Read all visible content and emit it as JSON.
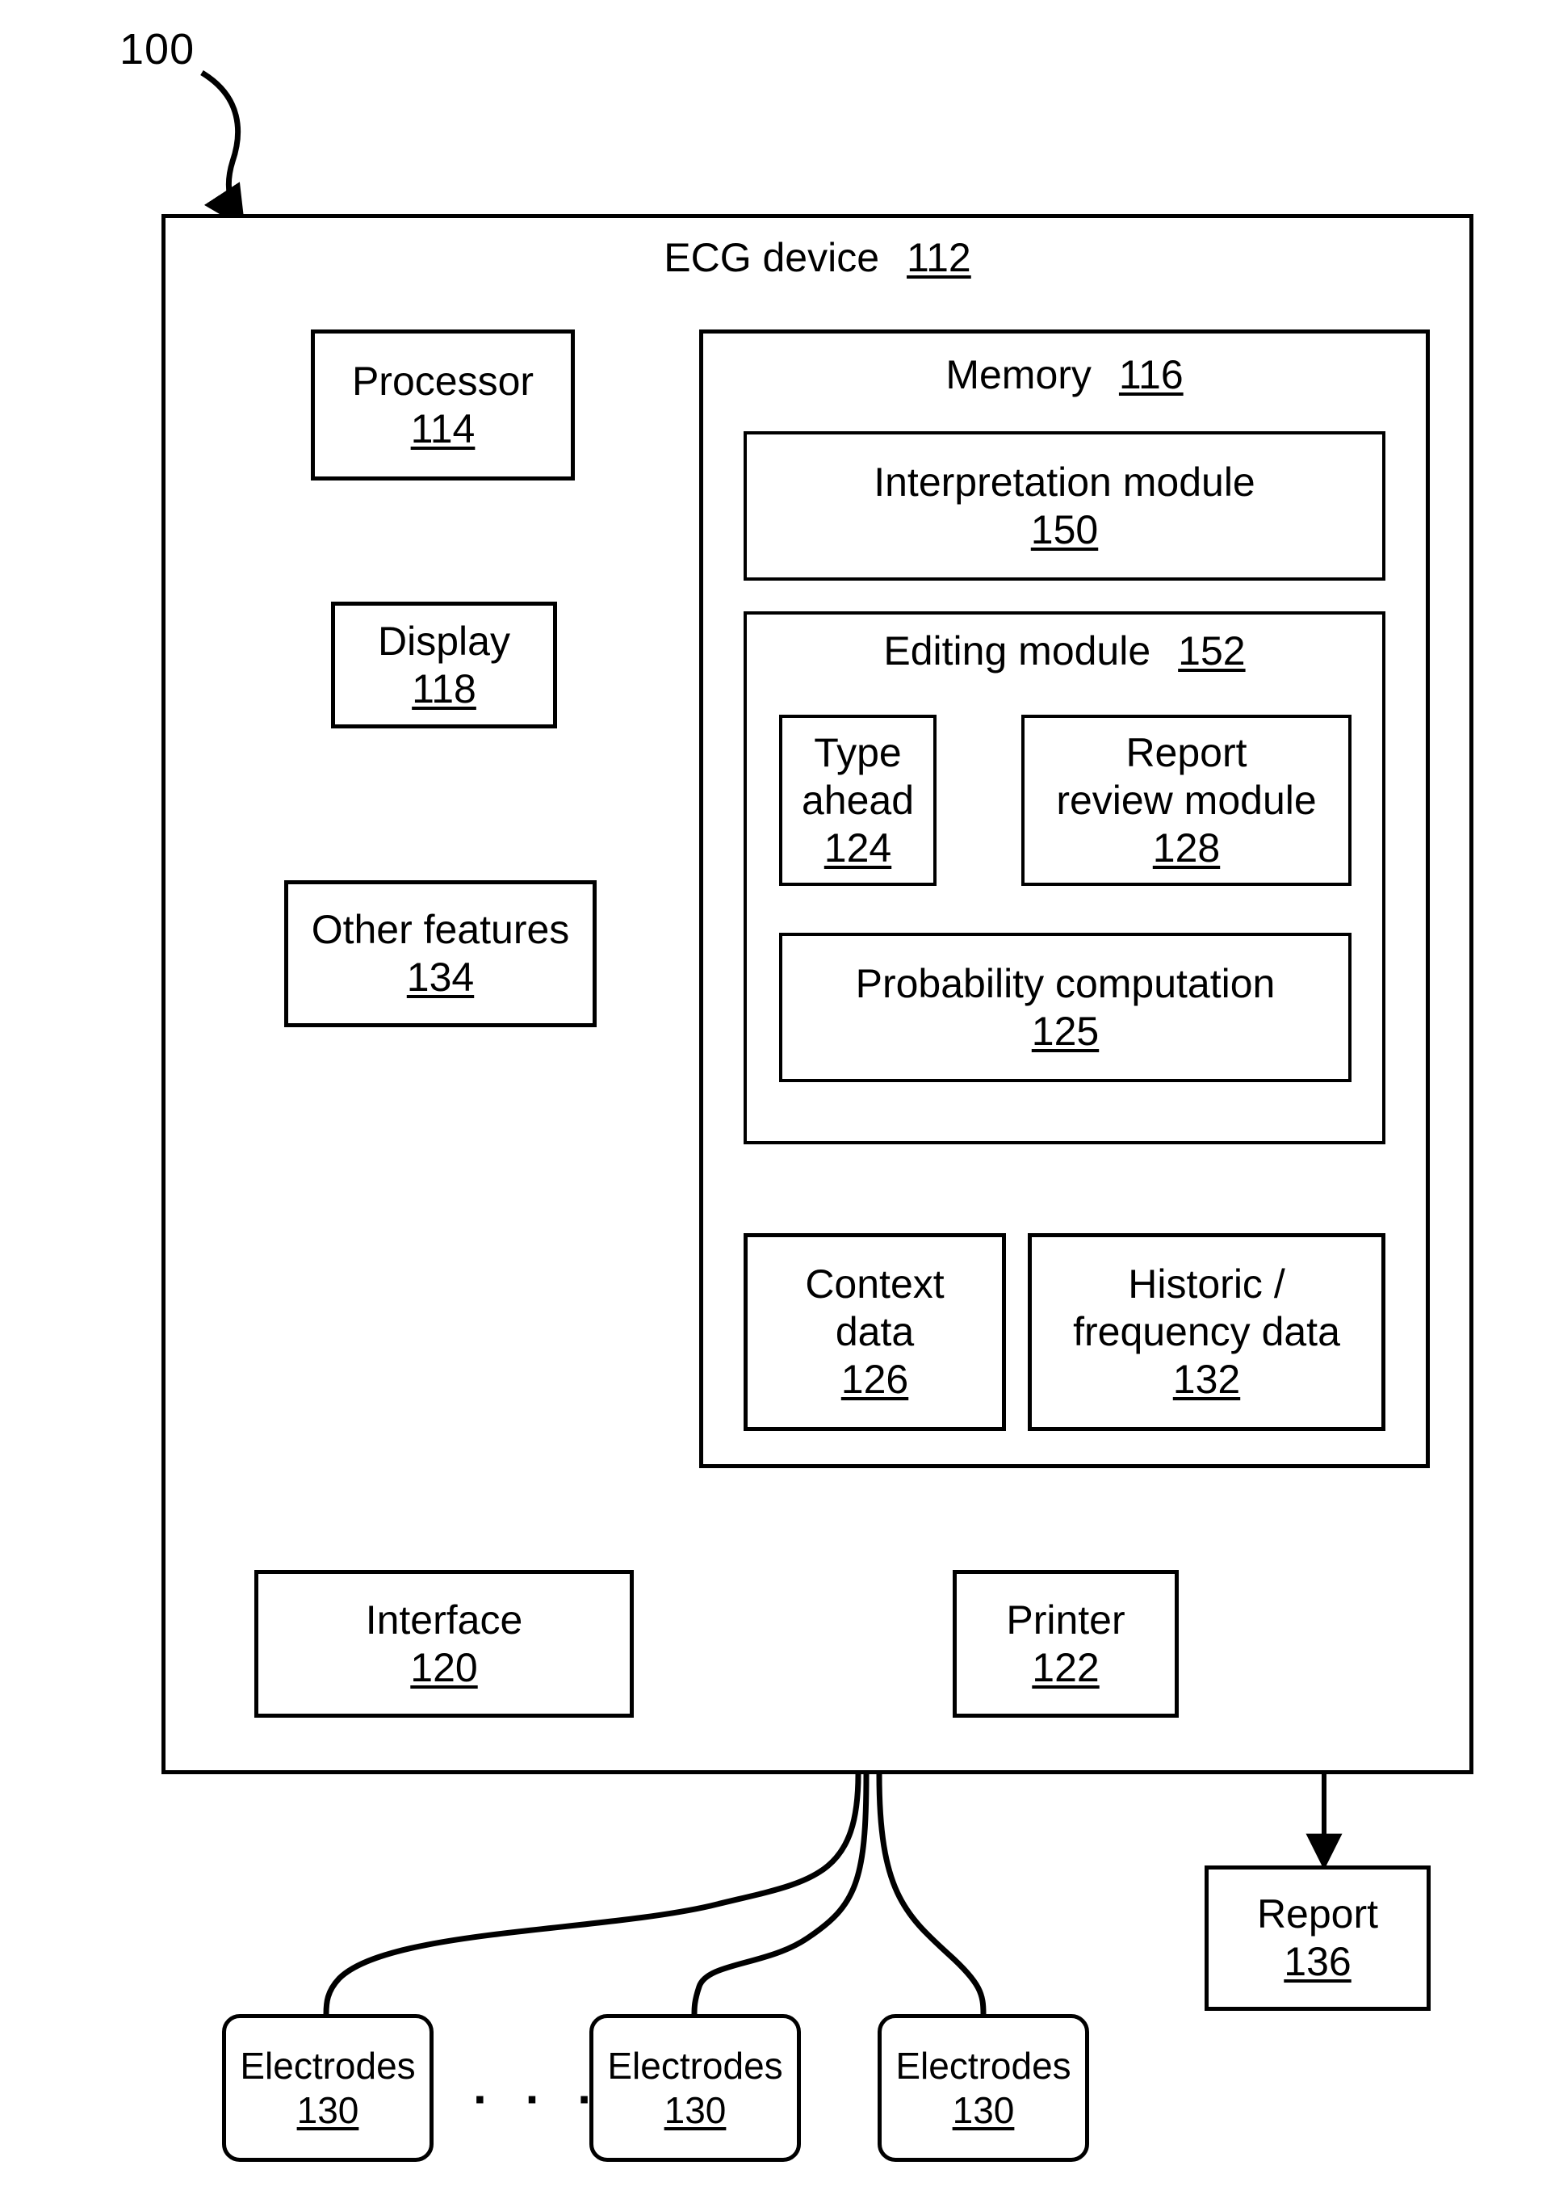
{
  "figure": {
    "reference_numeral": "100",
    "device_title_label": "ECG device",
    "device_title_number": "112"
  },
  "blocks": {
    "processor": {
      "label": "Processor",
      "number": "114"
    },
    "display": {
      "label": "Display",
      "number": "118"
    },
    "other_features": {
      "label": "Other features",
      "number": "134"
    },
    "interface": {
      "label": "Interface",
      "number": "120"
    },
    "memory": {
      "label": "Memory",
      "number": "116"
    },
    "interpretation_module": {
      "label": "Interpretation module",
      "number": "150"
    },
    "editing_module": {
      "label": "Editing module",
      "number": "152"
    },
    "type_ahead": {
      "label": "Type\nahead",
      "number": "124"
    },
    "report_review_module": {
      "label": "Report\nreview module",
      "number": "128"
    },
    "probability_computation": {
      "label": "Probability computation",
      "number": "125"
    },
    "context_data": {
      "label": "Context\ndata",
      "number": "126"
    },
    "historic_frequency_data": {
      "label": "Historic /\nfrequency data",
      "number": "132"
    },
    "printer": {
      "label": "Printer",
      "number": "122"
    },
    "report": {
      "label": "Report",
      "number": "136"
    },
    "electrodes_1": {
      "label": "Electrodes",
      "number": "130"
    },
    "electrodes_2": {
      "label": "Electrodes",
      "number": "130"
    },
    "electrodes_3": {
      "label": "Electrodes",
      "number": "130"
    }
  },
  "annotations": {
    "electrodes_ellipsis": "· · ·"
  },
  "style": {
    "line_color": "#000000",
    "background": "#ffffff"
  }
}
